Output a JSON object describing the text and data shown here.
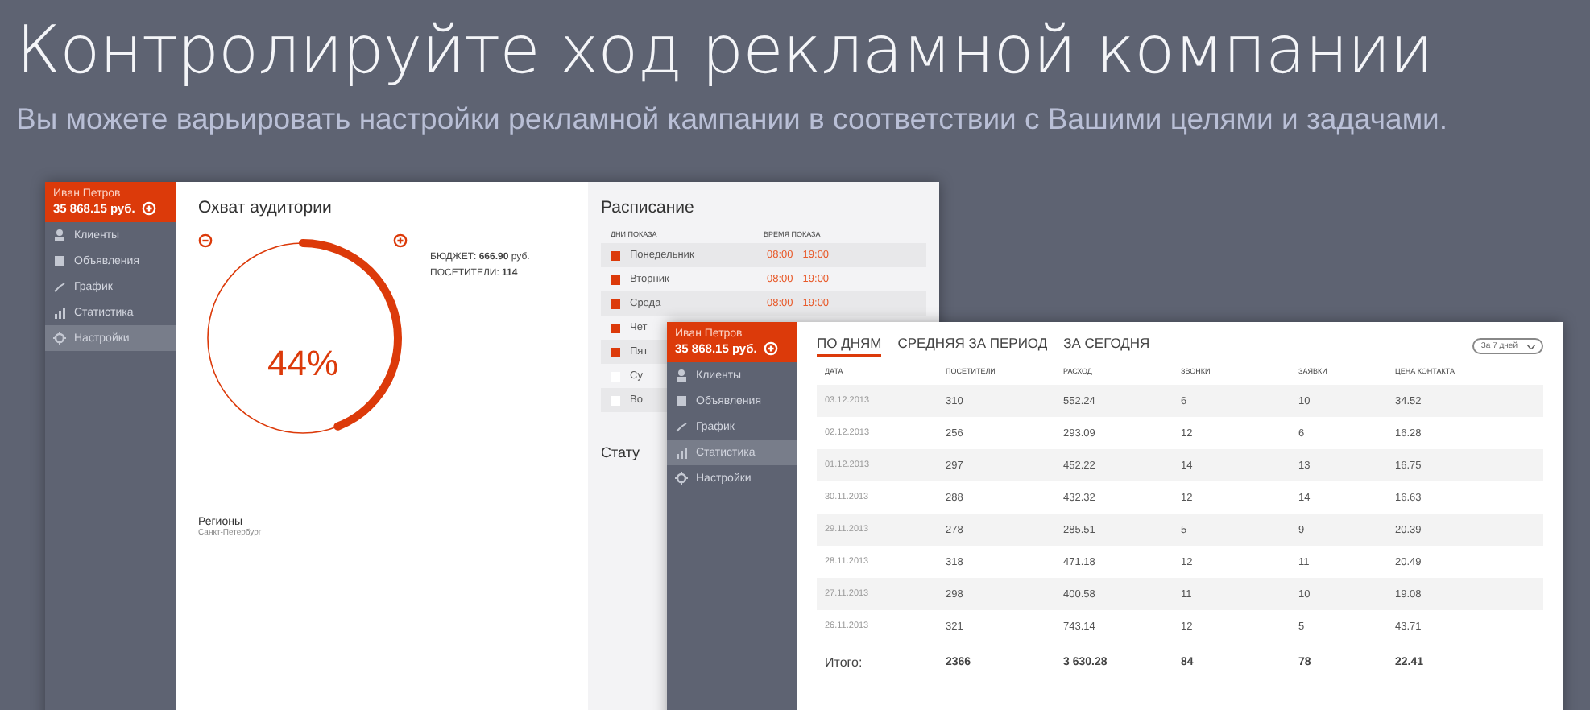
{
  "headline": "Контролируйте ход рекламной компании",
  "subheadline": "Вы можете варьировать настройки рекламной кампании в соответствии с Вашими целями и задачами.",
  "screen_1": {
    "user": {
      "name": "Иван Петров",
      "balance": "35 868.15 руб."
    },
    "sidebar": [
      {
        "label": "Клиенты",
        "selected": false
      },
      {
        "label": "Объявления",
        "selected": false
      },
      {
        "label": "График",
        "selected": false
      },
      {
        "label": "Статистика",
        "selected": false
      },
      {
        "label": "Настройки",
        "selected": true
      }
    ],
    "reach": {
      "title": "Охват аудитории",
      "level": 0.44,
      "percent": "44%",
      "budget": "БЮДЖЕТ: **666.90** руб.",
      "visitors": "ПОСЕТИТЕЛИ: **114**"
    },
    "regions": {
      "title": "Регионы",
      "value": "Санкт-Петербург"
    },
    "schedule": {
      "title": "Расписание",
      "columns": [
        "ДНИ ПОКАЗА",
        "ВРЕМЯ ПОКАЗА"
      ],
      "rows": [
        {
          "day": "Понедельник",
          "checked": true,
          "from": "08:00",
          "to": "19:00"
        },
        {
          "day": "Вторник",
          "checked": true,
          "from": "08:00",
          "to": "19:00"
        },
        {
          "day": "Среда",
          "checked": true,
          "from": "08:00",
          "to": "19:00"
        },
        {
          "day": "Чет",
          "checked": true
        },
        {
          "day": "Пят",
          "checked": true
        },
        {
          "day": "Су",
          "checked": false
        },
        {
          "day": "Во",
          "checked": false
        }
      ]
    },
    "status_title": "Стату"
  },
  "screen_2": {
    "user": {
      "name": "Иван Петров",
      "balance": "35 868.15 руб."
    },
    "sidebar": [
      {
        "label": "Клиенты",
        "selected": false
      },
      {
        "label": "Объявления",
        "selected": false
      },
      {
        "label": "График",
        "selected": false
      },
      {
        "label": "Статистика",
        "selected": true
      },
      {
        "label": "Настройки",
        "selected": false
      }
    ],
    "tabs": [
      {
        "label": "ПО ДНЯМ",
        "selected": true
      },
      {
        "label": "СРЕДНЯЯ ЗА ПЕРИОД",
        "selected": false
      },
      {
        "label": "ЗА СЕГОДНЯ",
        "selected": false
      }
    ],
    "period": "За 7 дней",
    "table": {
      "columns": [
        "ДАТА",
        "ПОСЕТИТЕЛИ",
        "РАСХОД",
        "ЗВОНКИ",
        "ЗАЯВКИ",
        "ЦЕНА КОНТАКТА"
      ],
      "rows": [
        [
          "03.12.2013",
          "310",
          "552.24",
          "6",
          "10",
          "34.52"
        ],
        [
          "02.12.2013",
          "256",
          "293.09",
          "12",
          "6",
          "16.28"
        ],
        [
          "01.12.2013",
          "297",
          "452.22",
          "14",
          "13",
          "16.75"
        ],
        [
          "30.11.2013",
          "288",
          "432.32",
          "12",
          "14",
          "16.63"
        ],
        [
          "29.11.2013",
          "278",
          "285.51",
          "5",
          "9",
          "20.39"
        ],
        [
          "28.11.2013",
          "318",
          "471.18",
          "12",
          "11",
          "20.49"
        ],
        [
          "27.11.2013",
          "298",
          "400.58",
          "11",
          "10",
          "19.08"
        ],
        [
          "26.11.2013",
          "321",
          "743.14",
          "12",
          "5",
          "43.71"
        ]
      ],
      "total": [
        "Итого:",
        "2366",
        "3 630.28",
        "84",
        "78",
        "22.41"
      ]
    }
  }
}
